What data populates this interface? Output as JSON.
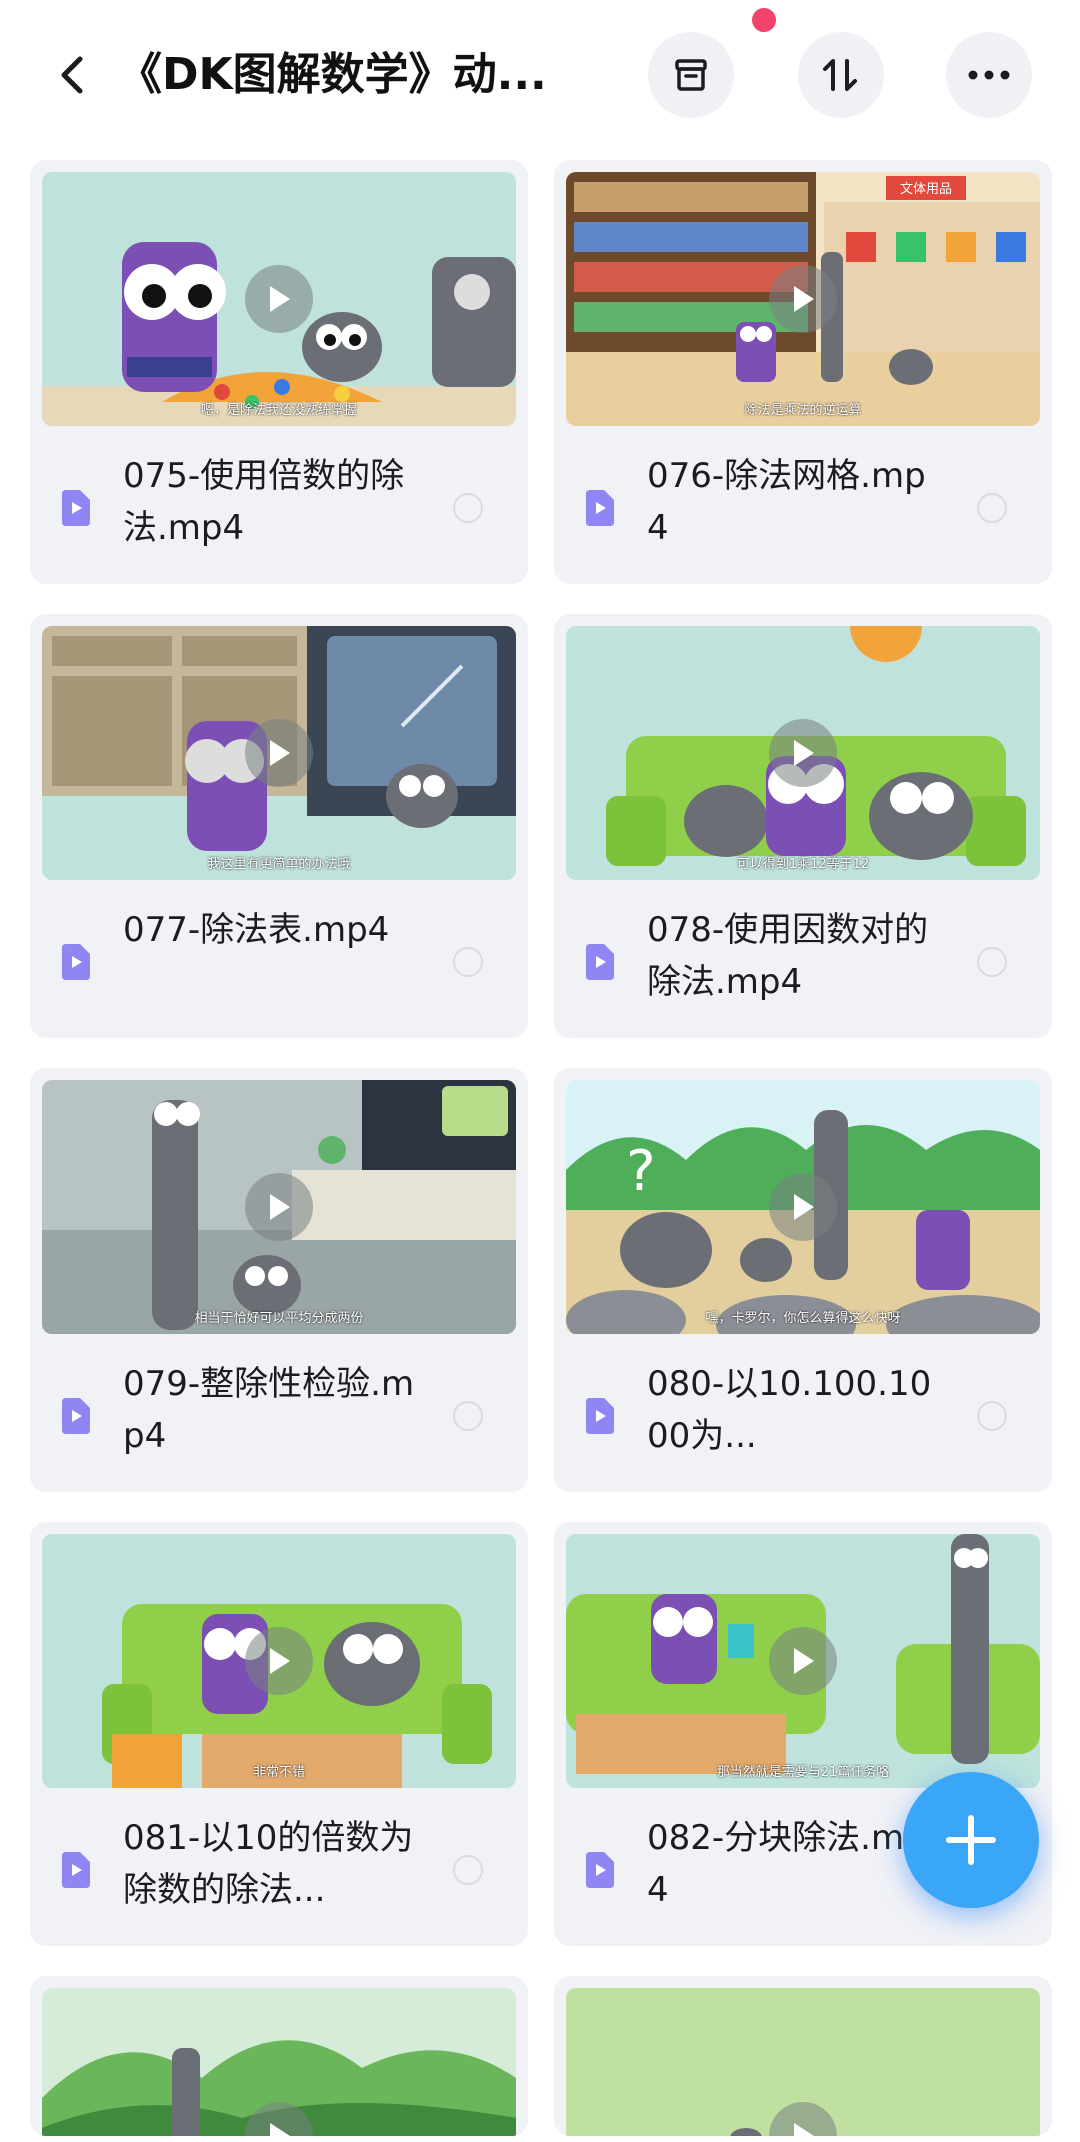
{
  "header": {
    "title": "《DK图解数学》动...",
    "back_icon": "chevron-left-icon",
    "archive_icon": "archive-box-icon",
    "sort_icon": "sort-arrows-icon",
    "more_icon": "more-dots-icon",
    "notification_dot_color": "#f2436a"
  },
  "files": [
    {
      "name": "075-使用倍数的除法.mp4",
      "caption": "嗯，是除法我还没熟练掌握"
    },
    {
      "name": "076-除法网格.mp4",
      "caption": "除法是乘法的逆运算",
      "sign": "文体用品"
    },
    {
      "name": "077-除法表.mp4",
      "caption": "我这里有更简单的办法哦"
    },
    {
      "name": "078-使用因数对的除法.mp4",
      "caption": "可以得到1乘12等于12"
    },
    {
      "name": "079-整除性检验.mp4",
      "caption": "相当于恰好可以平均分成两份"
    },
    {
      "name": "080-以10.100.1000为...",
      "caption": "嘿，卡罗尔，你怎么算得这么快呀"
    },
    {
      "name": "081-以10的倍数为除数的除法...",
      "caption": "非常不错"
    },
    {
      "name": "082-分块除法.mp4",
      "caption": "那当然就是需要与21篇任务咯"
    },
    {
      "name": "",
      "caption": ""
    },
    {
      "name": "",
      "caption": ""
    }
  ],
  "fab": {
    "icon": "plus-icon",
    "color": "#3aa6f7"
  },
  "colors": {
    "card_bg": "#f1f2f6",
    "file_icon": "#8f86f3",
    "accent": "#3aa6f7"
  }
}
